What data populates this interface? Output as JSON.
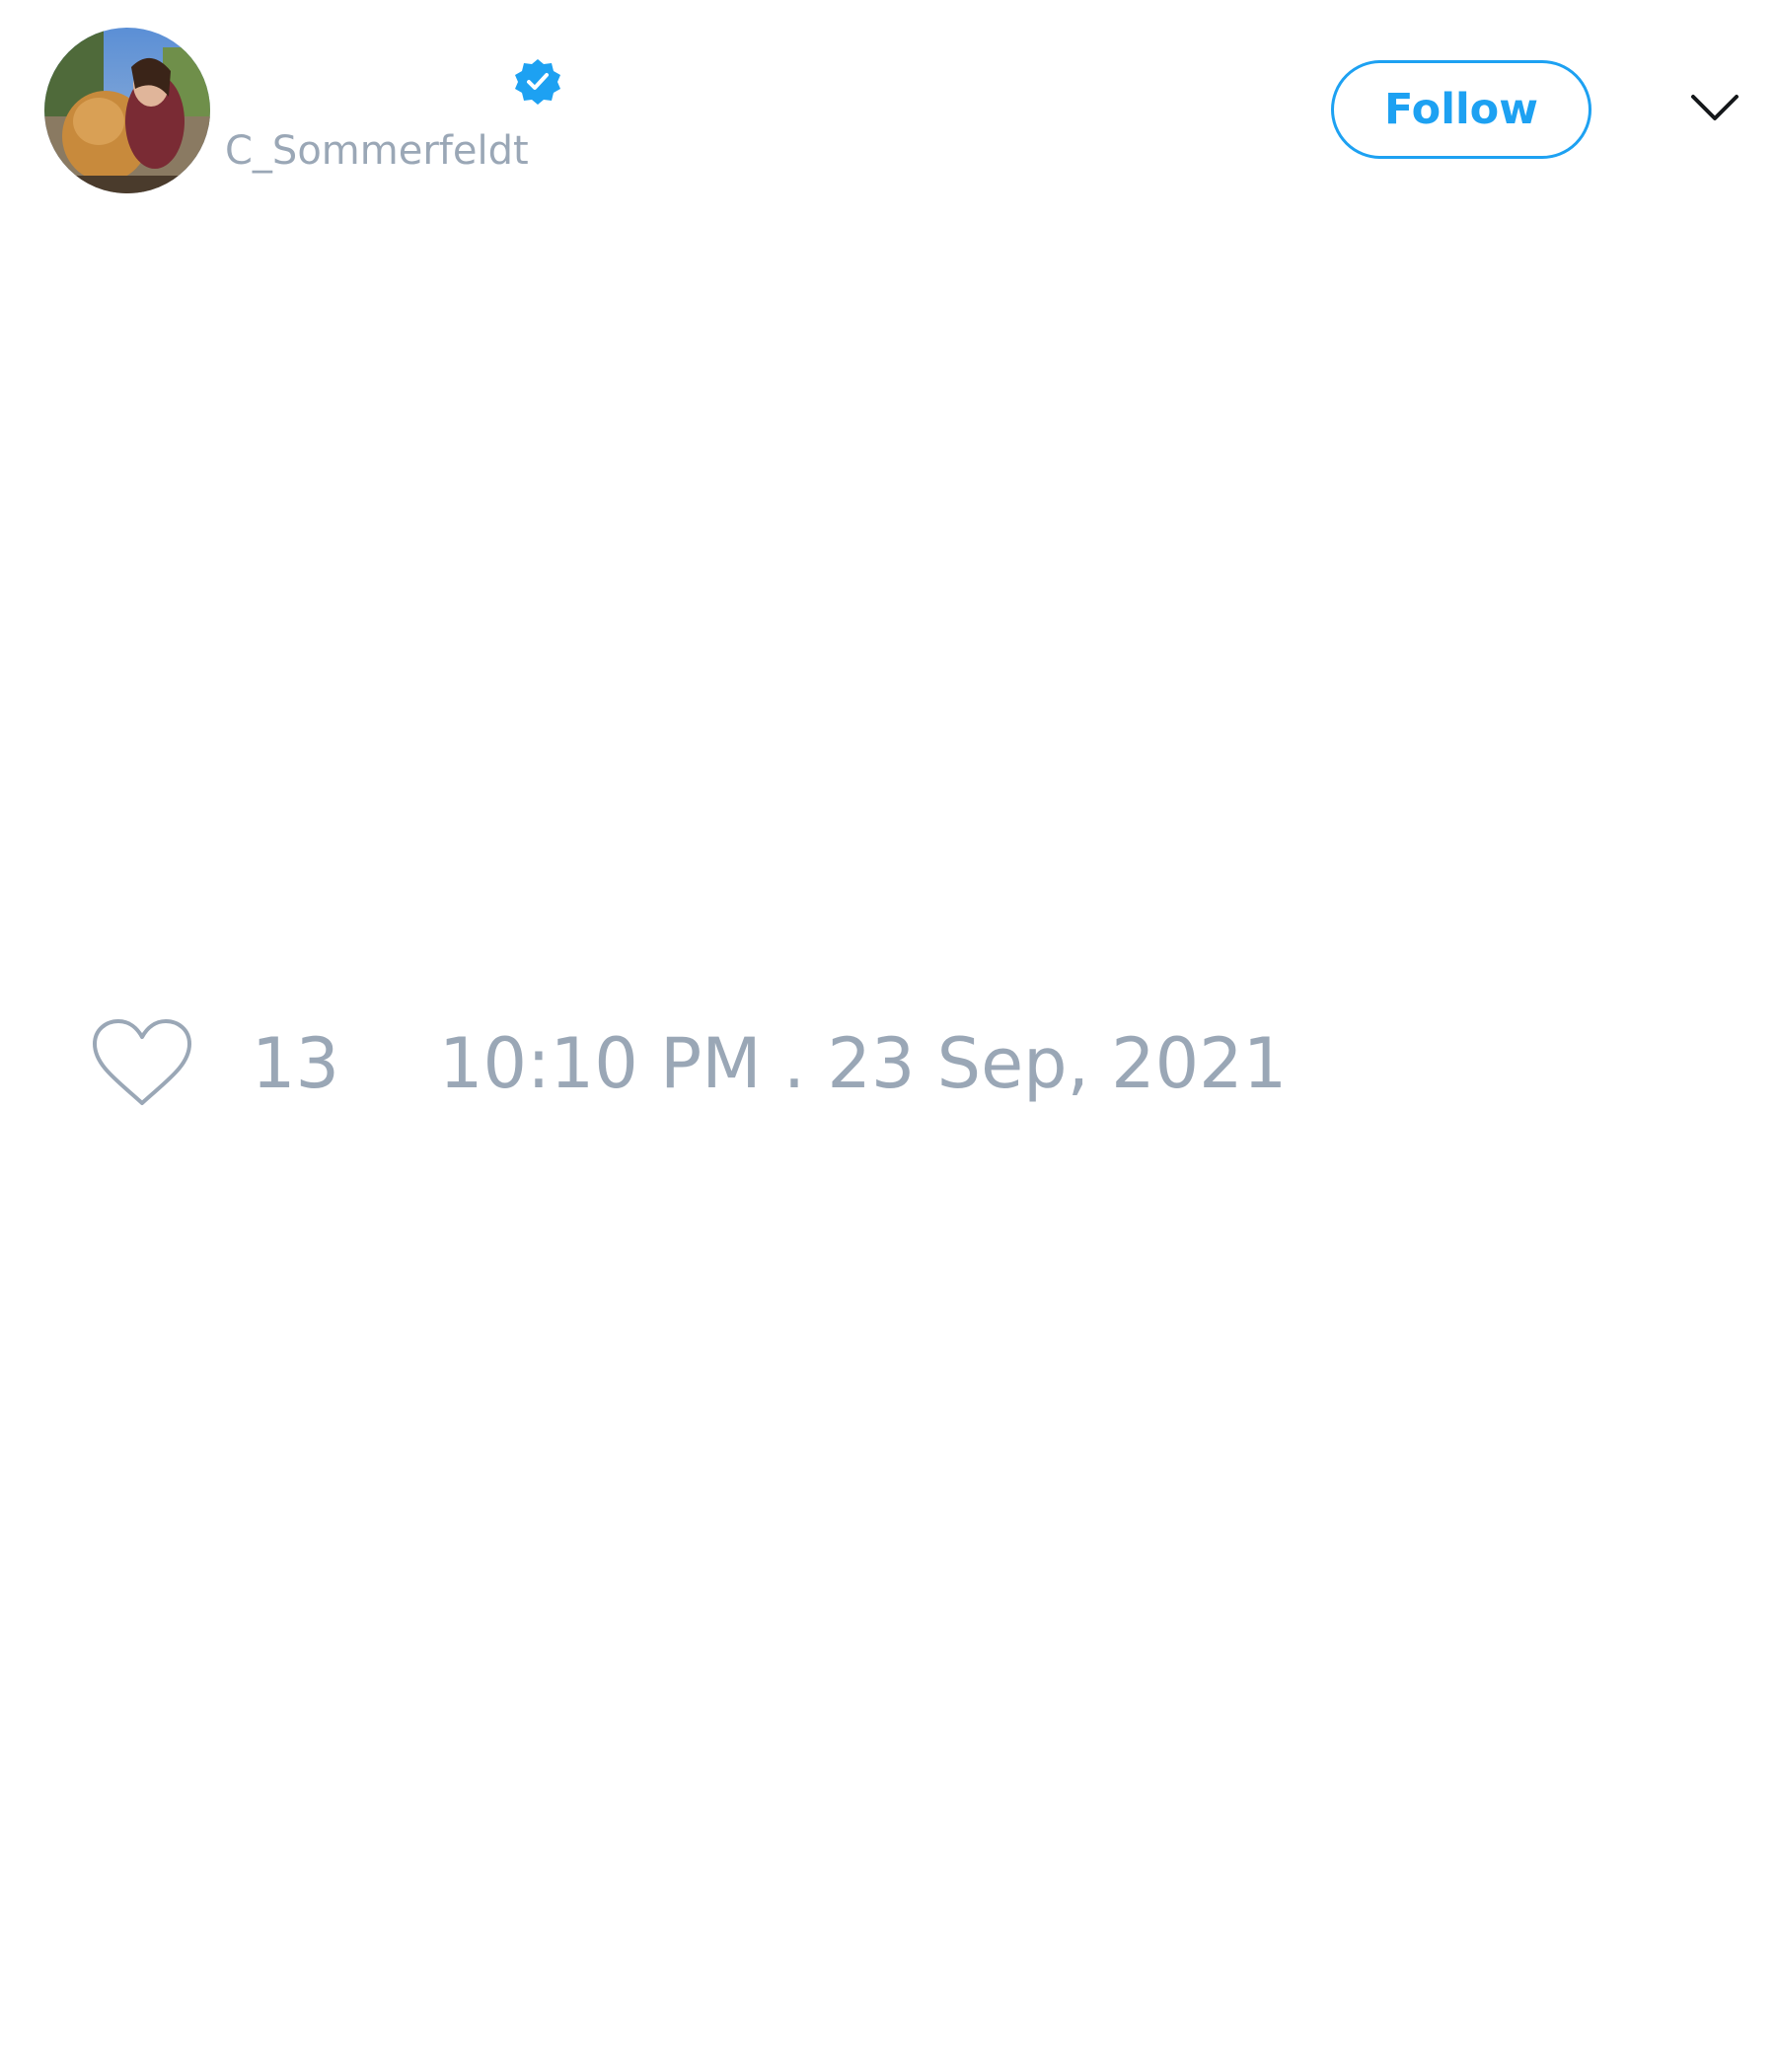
{
  "tweet": {
    "author": {
      "display_name": "",
      "handle": "C_Sommerfeldt",
      "verified": true,
      "avatar_icon": "profile-photo-person-with-dog"
    },
    "follow_label": "Follow",
    "menu_icon": "chevron-down-icon",
    "body_text": "",
    "likes": "13",
    "timestamp": "10:10 PM . 23 Sep, 2021"
  },
  "colors": {
    "accent": "#1da1f2",
    "muted_text": "#9aa7b6",
    "background": "#ffffff"
  }
}
